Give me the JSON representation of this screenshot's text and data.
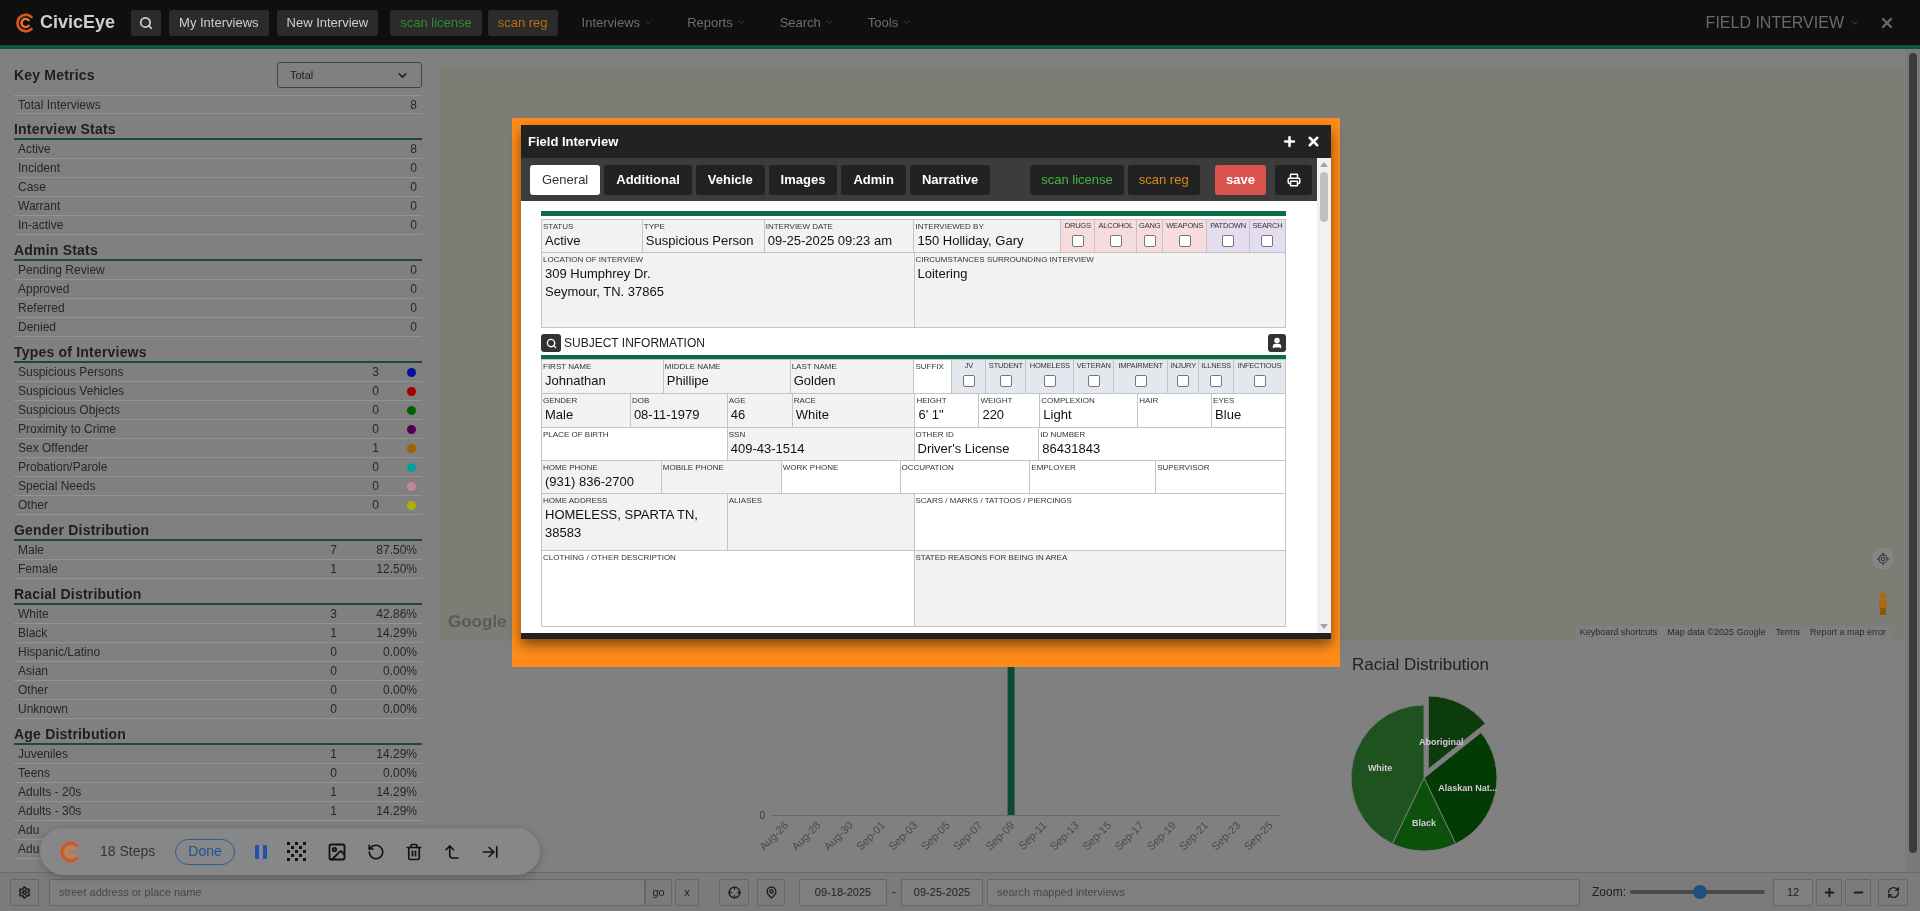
{
  "nav": {
    "logo": "CivicEye",
    "buttons": [
      "My Interviews",
      "New Interview"
    ],
    "scan_license": "scan license",
    "scan_reg": "scan reg",
    "menus": [
      "Interviews",
      "Reports",
      "Search",
      "Tools"
    ],
    "page_title": "FIELD INTERVIEW"
  },
  "metrics": {
    "title": "Key Metrics",
    "select": "Total",
    "total": {
      "label": "Total Interviews",
      "value": "8"
    },
    "sections": [
      {
        "kind": "plain",
        "title": "Interview Stats",
        "rows": [
          {
            "label": "Active",
            "value": "8"
          },
          {
            "label": "Incident",
            "value": "0"
          },
          {
            "label": "Case",
            "value": "0"
          },
          {
            "label": "Warrant",
            "value": "0"
          },
          {
            "label": "In-active",
            "value": "0"
          }
        ]
      },
      {
        "kind": "plain",
        "title": "Admin Stats",
        "rows": [
          {
            "label": "Pending Review",
            "value": "0"
          },
          {
            "label": "Approved",
            "value": "0"
          },
          {
            "label": "Referred",
            "value": "0"
          },
          {
            "label": "Denied",
            "value": "0"
          }
        ]
      },
      {
        "kind": "dot",
        "title": "Types of Interviews",
        "rows": [
          {
            "label": "Suspicious Persons",
            "value": "3",
            "color": "#0010a0"
          },
          {
            "label": "Suspicious Vehicles",
            "value": "0",
            "color": "#a00000"
          },
          {
            "label": "Suspicious Objects",
            "value": "0",
            "color": "#006000"
          },
          {
            "label": "Proximity to Crime",
            "value": "0",
            "color": "#500050"
          },
          {
            "label": "Sex Offender",
            "value": "1",
            "color": "#a06000"
          },
          {
            "label": "Probation/Parole",
            "value": "0",
            "color": "#00a0a0"
          },
          {
            "label": "Special Needs",
            "value": "0",
            "color": "#c08890"
          },
          {
            "label": "Other",
            "value": "0",
            "color": "#b0b000"
          }
        ]
      },
      {
        "kind": "percent",
        "title": "Gender Distribution",
        "rows": [
          {
            "label": "Male",
            "value": "7",
            "percent": "87.50%"
          },
          {
            "label": "Female",
            "value": "1",
            "percent": "12.50%"
          }
        ]
      },
      {
        "kind": "percent",
        "title": "Racial Distribution",
        "rows": [
          {
            "label": "White",
            "value": "3",
            "percent": "42.86%"
          },
          {
            "label": "Black",
            "value": "1",
            "percent": "14.29%"
          },
          {
            "label": "Hispanic/Latino",
            "value": "0",
            "percent": "0.00%"
          },
          {
            "label": "Asian",
            "value": "0",
            "percent": "0.00%"
          },
          {
            "label": "Other",
            "value": "0",
            "percent": "0.00%"
          },
          {
            "label": "Unknown",
            "value": "0",
            "percent": "0.00%"
          }
        ]
      },
      {
        "kind": "percent",
        "title": "Age Distribution",
        "rows": [
          {
            "label": "Juveniles",
            "value": "1",
            "percent": "14.29%"
          },
          {
            "label": "Teens",
            "value": "0",
            "percent": "0.00%"
          },
          {
            "label": "Adults - 20s",
            "value": "1",
            "percent": "14.29%"
          },
          {
            "label": "Adults - 30s",
            "value": "1",
            "percent": "14.29%"
          }
        ],
        "partial_rows": [
          "Adu",
          "Adu"
        ]
      }
    ]
  },
  "map": {
    "logo": "Google",
    "attribution": [
      "Keyboard shortcuts",
      "Map data ©2025 Google",
      "Terms",
      "Report a map error"
    ]
  },
  "modal": {
    "title": "Field Interview",
    "tabs": [
      {
        "label": "General",
        "selected": true
      },
      {
        "label": "Additional",
        "selected": false
      },
      {
        "label": "Vehicle",
        "selected": false
      },
      {
        "label": "Images",
        "selected": false
      },
      {
        "label": "Admin",
        "selected": false
      },
      {
        "label": "Narrative",
        "selected": false
      }
    ],
    "scan_license": "scan license",
    "scan_reg": "scan reg",
    "save": "save",
    "incident_rows": [
      [
        {
          "kind": "field",
          "label": "STATUS",
          "value": "Active",
          "shaded": true
        },
        {
          "kind": "field",
          "label": "TYPE",
          "value": "Suspicious Person",
          "shaded": true
        },
        {
          "kind": "field",
          "label": "INTERVIEW DATE",
          "value": "09-25-2025 09:23 am",
          "shaded": true
        },
        {
          "kind": "field",
          "label": "INTERVIEWED BY",
          "value": "150 Holliday, Gary",
          "shaded": true
        },
        {
          "kind": "flag",
          "label": "DRUGS",
          "checked": false,
          "color": "#f6dcdc"
        },
        {
          "kind": "flag",
          "label": "ALCOHOL",
          "checked": false,
          "color": "#f6dcdc"
        },
        {
          "kind": "flag",
          "label": "GANG",
          "checked": false,
          "color": "#f6dcdc"
        },
        {
          "kind": "flag",
          "label": "WEAPONS",
          "checked": false,
          "color": "#f6dcdc"
        },
        {
          "kind": "flag",
          "label": "PATDOWN",
          "checked": false,
          "color": "#e4dcef"
        },
        {
          "kind": "flag",
          "label": "SEARCH",
          "checked": false,
          "color": "#e4dcef"
        }
      ],
      [
        {
          "kind": "field",
          "label": "LOCATION OF INTERVIEW",
          "value": "309 Humphrey Dr.\nSeymour, TN. 37865",
          "shaded": true
        },
        {
          "kind": "field",
          "label": "CIRCUMSTANCES SURROUNDING INTERVIEW",
          "value": "Loitering",
          "shaded": true
        }
      ]
    ],
    "subject_title": "SUBJECT INFORMATION",
    "subject_rows": [
      [
        {
          "kind": "field",
          "label": "FIRST NAME",
          "value": "Johnathan",
          "shaded": true
        },
        {
          "kind": "field",
          "label": "MIDDLE NAME",
          "value": "Phillipe",
          "shaded": true
        },
        {
          "kind": "field",
          "label": "LAST NAME",
          "value": "Golden",
          "shaded": true
        },
        {
          "kind": "field",
          "label": "SUFFIX",
          "shaded": false
        },
        {
          "kind": "flag",
          "label": "JV",
          "checked": false,
          "color": "#e3e7ee"
        },
        {
          "kind": "flag",
          "label": "STUDENT",
          "checked": false,
          "color": "#e3e7ee"
        },
        {
          "kind": "flag",
          "label": "HOMELESS",
          "checked": false,
          "color": "#e3e7ee"
        },
        {
          "kind": "flag",
          "label": "VETERAN",
          "checked": false,
          "color": "#e3e7ee"
        },
        {
          "kind": "flag",
          "label": "IMPAIRMENT",
          "checked": false,
          "color": "#e3e7ee"
        },
        {
          "kind": "flag",
          "label": "INJURY",
          "checked": false,
          "color": "#e3e7ee"
        },
        {
          "kind": "flag",
          "label": "ILLNESS",
          "checked": false,
          "color": "#e3e7ee"
        },
        {
          "kind": "flag",
          "label": "INFECTIOUS",
          "checked": false,
          "color": "#e3e7ee"
        }
      ],
      [
        {
          "kind": "field",
          "label": "GENDER",
          "value": "Male",
          "shaded": true
        },
        {
          "kind": "field",
          "label": "DOB",
          "value": "08-11-1979",
          "shaded": true
        },
        {
          "kind": "field",
          "label": "AGE",
          "value": "46",
          "shaded": true
        },
        {
          "kind": "field",
          "label": "RACE",
          "value": "White",
          "shaded": true
        },
        {
          "kind": "field",
          "label": "HEIGHT",
          "value": "6' 1\"",
          "shaded": false
        },
        {
          "kind": "field",
          "label": "WEIGHT",
          "value": "220",
          "shaded": false
        },
        {
          "kind": "field",
          "label": "COMPLEXION",
          "value": "Light",
          "shaded": false
        },
        {
          "kind": "field",
          "label": "HAIR",
          "shaded": false
        },
        {
          "kind": "field",
          "label": "EYES",
          "value": "Blue",
          "shaded": false
        }
      ],
      [
        {
          "kind": "field",
          "label": "PLACE OF BIRTH",
          "shaded": false
        },
        {
          "kind": "field",
          "label": "SSN",
          "value": "409-43-1514",
          "shaded": true
        },
        {
          "kind": "field",
          "label": "OTHER ID",
          "value": "Driver's License",
          "shaded": false
        },
        {
          "kind": "field",
          "label": "ID NUMBER",
          "value": "86431843",
          "shaded": false
        }
      ],
      [
        {
          "kind": "field",
          "label": "HOME PHONE",
          "value": "(931) 836-2700",
          "shaded": true
        },
        {
          "kind": "field",
          "label": "MOBILE PHONE",
          "shaded": true
        },
        {
          "kind": "field",
          "label": "WORK PHONE",
          "shaded": false
        },
        {
          "kind": "field",
          "label": "OCCUPATION",
          "shaded": false
        },
        {
          "kind": "field",
          "label": "EMPLOYER",
          "shaded": false
        },
        {
          "kind": "field",
          "label": "SUPERVISOR",
          "shaded": false
        }
      ],
      [
        {
          "kind": "field",
          "label": "HOME ADDRESS",
          "value": "HOMELESS, SPARTA TN, 38583",
          "shaded": true
        },
        {
          "kind": "field",
          "label": "ALIASES",
          "shaded": true
        },
        {
          "kind": "field",
          "label": "SCARS / MARKS / TATTOOS / PIERCINGS",
          "shaded": false
        }
      ],
      [
        {
          "kind": "field",
          "label": "CLOTHING / OTHER DESCRIPTION",
          "shaded": false
        },
        {
          "kind": "field",
          "label": "STATED REASONS FOR BEING IN AREA",
          "shaded": true
        }
      ]
    ]
  },
  "activity_chart": {
    "y_tick": "0",
    "x_labels": [
      {
        "label": "Aug-26",
        "bar": false
      },
      {
        "label": "Aug-28",
        "bar": false
      },
      {
        "label": "Aug-30",
        "bar": false
      },
      {
        "label": "Sep-01",
        "bar": false
      },
      {
        "label": "Sep-03",
        "bar": false
      },
      {
        "label": "Sep-05",
        "bar": false
      },
      {
        "label": "Sep-07",
        "bar": false
      },
      {
        "label": "Sep-09",
        "bar": true
      },
      {
        "label": "Sep-11",
        "bar": false
      },
      {
        "label": "Sep-13",
        "bar": false
      },
      {
        "label": "Sep-15",
        "bar": false
      },
      {
        "label": "Sep-17",
        "bar": false
      },
      {
        "label": "Sep-19",
        "bar": false
      },
      {
        "label": "Sep-21",
        "bar": false
      },
      {
        "label": "Sep-23",
        "bar": false
      },
      {
        "label": "Sep-25",
        "bar": false
      }
    ]
  },
  "race_pie": {
    "title": "Racial Distribution",
    "slices": [
      {
        "label": "Aboriginal",
        "color": "#0c3c0c"
      },
      {
        "label": "Alaskan Nat...",
        "color": "#043a04"
      },
      {
        "label": "Black",
        "color": "#0c500c"
      },
      {
        "label": "White",
        "color": "#1e521e"
      }
    ]
  },
  "recorder": {
    "steps": "18 Steps",
    "done": "Done"
  },
  "bottom_bar": {
    "address_placeholder": "street address or place name",
    "go": "go",
    "clear": "x",
    "date_from": "09-18-2025",
    "date_sep": "-",
    "date_to": "09-25-2025",
    "search_placeholder": "search mapped interviews",
    "zoom": {
      "label": "Zoom:",
      "level": 0.52,
      "value": "12"
    }
  }
}
